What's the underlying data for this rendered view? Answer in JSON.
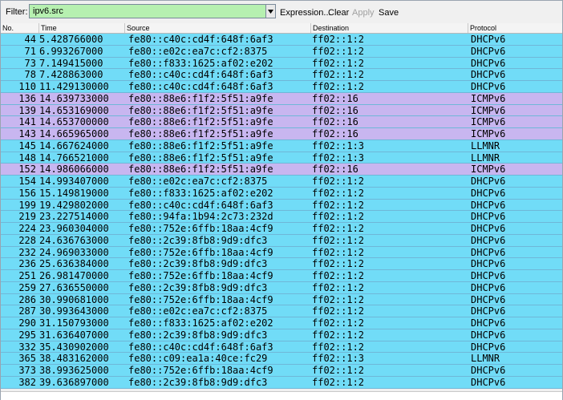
{
  "colors": {
    "dhcp_row": "#71dcf7",
    "icmp_row": "#c8b6f0",
    "llmnr_row": "#71dcf7",
    "filter_bg": "#b6f0b0"
  },
  "filter": {
    "label": "Filter:",
    "value": "ipv6.src",
    "dropdown_icon": "chevron-down-icon",
    "expression_label": "Expression...",
    "clear_label": "Clear",
    "apply_label": "Apply",
    "save_label": "Save"
  },
  "columns": {
    "no": "No.",
    "time": "Time",
    "source": "Source",
    "destination": "Destination",
    "protocol": "Protocol"
  },
  "packets": [
    {
      "no": "44",
      "time": "5.428766000",
      "source": "fe80::c40c:cd4f:648f:6af3",
      "destination": "ff02::1:2",
      "protocol": "DHCPv6"
    },
    {
      "no": "71",
      "time": "6.993267000",
      "source": "fe80::e02c:ea7c:cf2:8375",
      "destination": "ff02::1:2",
      "protocol": "DHCPv6"
    },
    {
      "no": "73",
      "time": "7.149415000",
      "source": "fe80::f833:1625:af02:e202",
      "destination": "ff02::1:2",
      "protocol": "DHCPv6"
    },
    {
      "no": "78",
      "time": "7.428863000",
      "source": "fe80::c40c:cd4f:648f:6af3",
      "destination": "ff02::1:2",
      "protocol": "DHCPv6"
    },
    {
      "no": "110",
      "time": "11.429130000",
      "source": "fe80::c40c:cd4f:648f:6af3",
      "destination": "ff02::1:2",
      "protocol": "DHCPv6"
    },
    {
      "no": "136",
      "time": "14.639733000",
      "source": "fe80::88e6:f1f2:5f51:a9fe",
      "destination": "ff02::16",
      "protocol": "ICMPv6"
    },
    {
      "no": "139",
      "time": "14.653169000",
      "source": "fe80::88e6:f1f2:5f51:a9fe",
      "destination": "ff02::16",
      "protocol": "ICMPv6"
    },
    {
      "no": "141",
      "time": "14.653700000",
      "source": "fe80::88e6:f1f2:5f51:a9fe",
      "destination": "ff02::16",
      "protocol": "ICMPv6"
    },
    {
      "no": "143",
      "time": "14.665965000",
      "source": "fe80::88e6:f1f2:5f51:a9fe",
      "destination": "ff02::16",
      "protocol": "ICMPv6"
    },
    {
      "no": "145",
      "time": "14.667624000",
      "source": "fe80::88e6:f1f2:5f51:a9fe",
      "destination": "ff02::1:3",
      "protocol": "LLMNR"
    },
    {
      "no": "148",
      "time": "14.766521000",
      "source": "fe80::88e6:f1f2:5f51:a9fe",
      "destination": "ff02::1:3",
      "protocol": "LLMNR"
    },
    {
      "no": "152",
      "time": "14.986066000",
      "source": "fe80::88e6:f1f2:5f51:a9fe",
      "destination": "ff02::16",
      "protocol": "ICMPv6"
    },
    {
      "no": "154",
      "time": "14.993407000",
      "source": "fe80::e02c:ea7c:cf2:8375",
      "destination": "ff02::1:2",
      "protocol": "DHCPv6"
    },
    {
      "no": "156",
      "time": "15.149819000",
      "source": "fe80::f833:1625:af02:e202",
      "destination": "ff02::1:2",
      "protocol": "DHCPv6"
    },
    {
      "no": "199",
      "time": "19.429802000",
      "source": "fe80::c40c:cd4f:648f:6af3",
      "destination": "ff02::1:2",
      "protocol": "DHCPv6"
    },
    {
      "no": "219",
      "time": "23.227514000",
      "source": "fe80::94fa:1b94:2c73:232d",
      "destination": "ff02::1:2",
      "protocol": "DHCPv6"
    },
    {
      "no": "224",
      "time": "23.960304000",
      "source": "fe80::752e:6ffb:18aa:4cf9",
      "destination": "ff02::1:2",
      "protocol": "DHCPv6"
    },
    {
      "no": "228",
      "time": "24.636763000",
      "source": "fe80::2c39:8fb8:9d9:dfc3",
      "destination": "ff02::1:2",
      "protocol": "DHCPv6"
    },
    {
      "no": "232",
      "time": "24.969033000",
      "source": "fe80::752e:6ffb:18aa:4cf9",
      "destination": "ff02::1:2",
      "protocol": "DHCPv6"
    },
    {
      "no": "236",
      "time": "25.636384000",
      "source": "fe80::2c39:8fb8:9d9:dfc3",
      "destination": "ff02::1:2",
      "protocol": "DHCPv6"
    },
    {
      "no": "251",
      "time": "26.981470000",
      "source": "fe80::752e:6ffb:18aa:4cf9",
      "destination": "ff02::1:2",
      "protocol": "DHCPv6"
    },
    {
      "no": "259",
      "time": "27.636550000",
      "source": "fe80::2c39:8fb8:9d9:dfc3",
      "destination": "ff02::1:2",
      "protocol": "DHCPv6"
    },
    {
      "no": "286",
      "time": "30.990681000",
      "source": "fe80::752e:6ffb:18aa:4cf9",
      "destination": "ff02::1:2",
      "protocol": "DHCPv6"
    },
    {
      "no": "287",
      "time": "30.993643000",
      "source": "fe80::e02c:ea7c:cf2:8375",
      "destination": "ff02::1:2",
      "protocol": "DHCPv6"
    },
    {
      "no": "290",
      "time": "31.150793000",
      "source": "fe80::f833:1625:af02:e202",
      "destination": "ff02::1:2",
      "protocol": "DHCPv6"
    },
    {
      "no": "295",
      "time": "31.636407000",
      "source": "fe80::2c39:8fb8:9d9:dfc3",
      "destination": "ff02::1:2",
      "protocol": "DHCPv6"
    },
    {
      "no": "332",
      "time": "35.430902000",
      "source": "fe80::c40c:cd4f:648f:6af3",
      "destination": "ff02::1:2",
      "protocol": "DHCPv6"
    },
    {
      "no": "365",
      "time": "38.483162000",
      "source": "fe80::c09:ea1a:40ce:fc29",
      "destination": "ff02::1:3",
      "protocol": "LLMNR"
    },
    {
      "no": "373",
      "time": "38.993625000",
      "source": "fe80::752e:6ffb:18aa:4cf9",
      "destination": "ff02::1:2",
      "protocol": "DHCPv6"
    },
    {
      "no": "382",
      "time": "39.636897000",
      "source": "fe80::2c39:8fb8:9d9:dfc3",
      "destination": "ff02::1:2",
      "protocol": "DHCPv6"
    }
  ]
}
